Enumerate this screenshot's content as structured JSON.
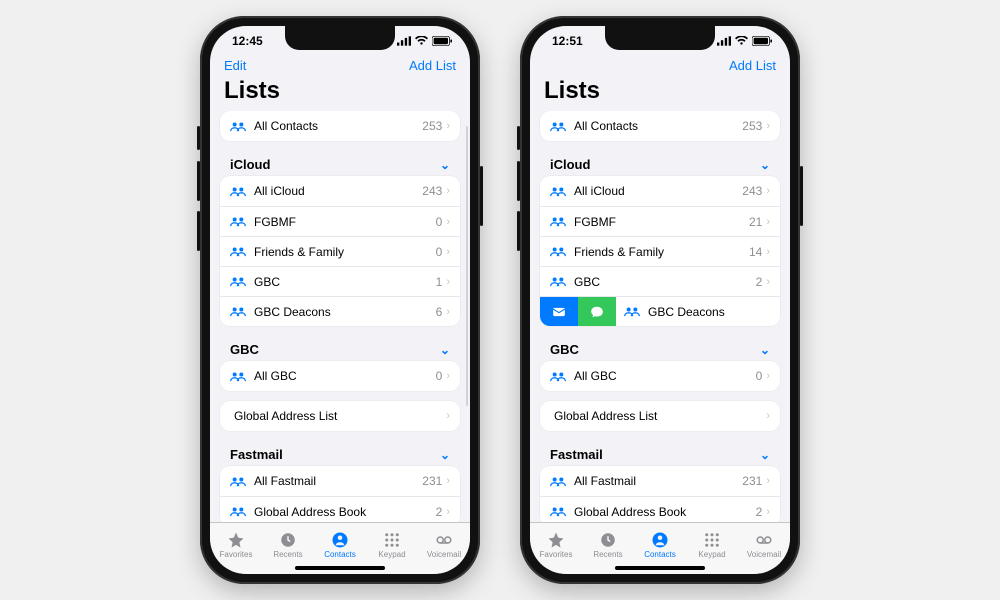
{
  "phones": [
    {
      "time": "12:45",
      "nav": {
        "left": "Edit",
        "right": "Add List"
      },
      "title": "Lists",
      "top_row": {
        "label": "All Contacts",
        "count": "253"
      },
      "sections": [
        {
          "header": "iCloud",
          "rows": [
            {
              "label": "All iCloud",
              "count": "243"
            },
            {
              "label": "FGBMF",
              "count": "0"
            },
            {
              "label": "Friends & Family",
              "count": "0"
            },
            {
              "label": "GBC",
              "count": "1"
            },
            {
              "label": "GBC Deacons",
              "count": "6"
            }
          ]
        },
        {
          "header": "GBC",
          "rows": [
            {
              "label": "All GBC",
              "count": "0"
            }
          ]
        },
        {
          "plain_rows": [
            {
              "label": "Global Address List"
            }
          ]
        },
        {
          "header": "Fastmail",
          "rows": [
            {
              "label": "All Fastmail",
              "count": "231"
            },
            {
              "label": "Global Address Book",
              "count": "2"
            }
          ]
        }
      ],
      "show_left_nav": true,
      "show_scroll": true
    },
    {
      "time": "12:51",
      "nav": {
        "left": "",
        "right": "Add List"
      },
      "title": "Lists",
      "top_row": {
        "label": "All Contacts",
        "count": "253"
      },
      "sections": [
        {
          "header": "iCloud",
          "rows": [
            {
              "label": "All iCloud",
              "count": "243"
            },
            {
              "label": "FGBMF",
              "count": "21"
            },
            {
              "label": "Friends & Family",
              "count": "14"
            },
            {
              "label": "GBC",
              "count": "2"
            },
            {
              "label": "GBC Deacons",
              "swiped": true
            }
          ]
        },
        {
          "header": "GBC",
          "rows": [
            {
              "label": "All GBC",
              "count": "0"
            }
          ]
        },
        {
          "plain_rows": [
            {
              "label": "Global Address List"
            }
          ]
        },
        {
          "header": "Fastmail",
          "rows": [
            {
              "label": "All Fastmail",
              "count": "231"
            },
            {
              "label": "Global Address Book",
              "count": "2"
            }
          ]
        }
      ],
      "show_left_nav": false,
      "show_scroll": false
    }
  ],
  "tabs": [
    {
      "name": "Favorites"
    },
    {
      "name": "Recents"
    },
    {
      "name": "Contacts",
      "active": true
    },
    {
      "name": "Keypad"
    },
    {
      "name": "Voicemail"
    }
  ]
}
